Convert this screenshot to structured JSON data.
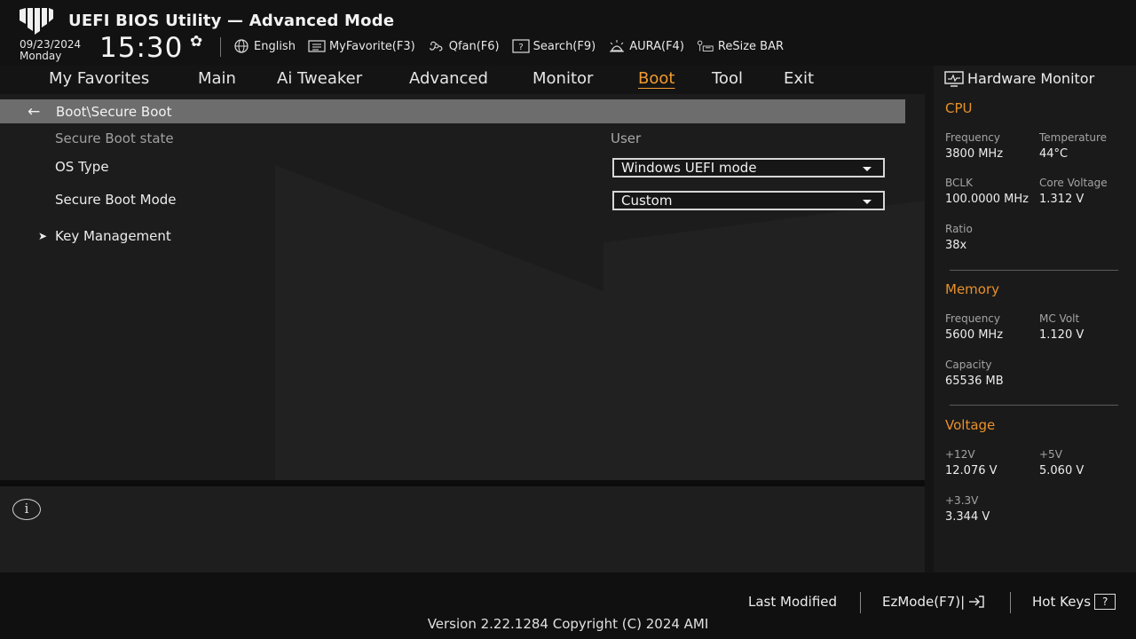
{
  "header": {
    "title": "UEFI BIOS Utility — Advanced Mode",
    "date": "09/23/2024",
    "day": "Monday",
    "time": "15:30",
    "toolbar": [
      {
        "label": "English",
        "icon": "globe-icon"
      },
      {
        "label": "MyFavorite(F3)",
        "icon": "favorite-list-icon"
      },
      {
        "label": "Qfan(F6)",
        "icon": "fan-icon"
      },
      {
        "label": "Search(F9)",
        "icon": "search-help-icon"
      },
      {
        "label": "AURA(F4)",
        "icon": "aura-light-icon"
      },
      {
        "label": "ReSize BAR",
        "icon": "resize-bar-icon"
      }
    ]
  },
  "nav": {
    "tabs": [
      "My Favorites",
      "Main",
      "Ai Tweaker",
      "Advanced",
      "Monitor",
      "Boot",
      "Tool",
      "Exit"
    ],
    "active": "Boot"
  },
  "main": {
    "breadcrumb": "Boot\\Secure Boot",
    "rows": [
      {
        "label": "Secure Boot state",
        "value": "User"
      },
      {
        "label": "OS Type",
        "value": "Windows UEFI mode"
      },
      {
        "label": "Secure Boot Mode",
        "value": "Custom"
      },
      {
        "label": "Key Management"
      }
    ]
  },
  "help": {
    "icon": "info-icon"
  },
  "hardware_monitor": {
    "title": "Hardware Monitor",
    "accent_color": "#e8912a",
    "cpu": {
      "heading": "CPU",
      "frequency_label": "Frequency",
      "frequency": "3800 MHz",
      "temperature_label": "Temperature",
      "temperature": "44°C",
      "bclk_label": "BCLK",
      "bclk": "100.0000 MHz",
      "core_voltage_label": "Core Voltage",
      "core_voltage": "1.312 V",
      "ratio_label": "Ratio",
      "ratio": "38x"
    },
    "memory": {
      "heading": "Memory",
      "frequency_label": "Frequency",
      "frequency": "5600 MHz",
      "mc_volt_label": "MC Volt",
      "mc_volt": "1.120 V",
      "capacity_label": "Capacity",
      "capacity": "65536 MB"
    },
    "voltage": {
      "heading": "Voltage",
      "v12_label": "+12V",
      "v12": "12.076 V",
      "v5_label": "+5V",
      "v5": "5.060 V",
      "v33_label": "+3.3V",
      "v33": "3.344 V"
    }
  },
  "footer": {
    "last_modified": "Last Modified",
    "ezmode": "EzMode(F7)|",
    "hot_keys": "Hot Keys",
    "hot_keys_key": "?",
    "version": "Version 2.22.1284 Copyright (C) 2024 AMI"
  }
}
